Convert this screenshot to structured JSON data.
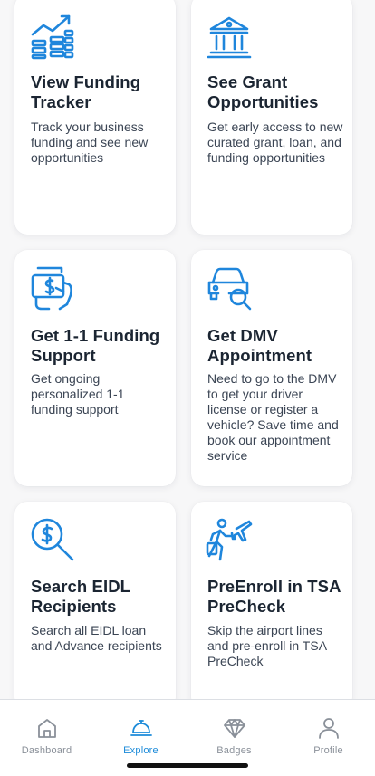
{
  "cards": [
    {
      "icon": "funding-tracker-icon",
      "title": "View Funding Tracker",
      "description": "Track your business funding and see new opportunities"
    },
    {
      "icon": "bank-building-icon",
      "title": "See Grant Opportunities",
      "description": "Get early access to new curated grant, loan, and funding opportunities"
    },
    {
      "icon": "funding-support-icon",
      "title": "Get 1-1 Funding Support",
      "description": "Get ongoing personalized 1-1 funding support"
    },
    {
      "icon": "car-search-icon",
      "title": "Get DMV Appointment",
      "description": "Need to go to the DMV to get your driver license or register a vehicle? Save time and book our appointment service"
    },
    {
      "icon": "dollar-search-icon",
      "title": "Search EIDL Recipients",
      "description": "Search all EIDL loan and Advance recipients"
    },
    {
      "icon": "traveler-plane-icon",
      "title": "PreEnroll in TSA PreCheck",
      "description": "Skip the airport lines and pre-enroll in TSA PreCheck"
    }
  ],
  "tabbar": {
    "tabs": [
      {
        "label": "Dashboard",
        "icon": "home-icon",
        "active": false
      },
      {
        "label": "Explore",
        "icon": "service-bell-icon",
        "active": true
      },
      {
        "label": "Badges",
        "icon": "diamond-icon",
        "active": false
      },
      {
        "label": "Profile",
        "icon": "person-icon",
        "active": false
      }
    ]
  },
  "colors": {
    "accent": "#1c8bd9",
    "icon_blue": "#1f86dc",
    "title": "#1b2532",
    "inactive_tab": "#8a9099"
  }
}
